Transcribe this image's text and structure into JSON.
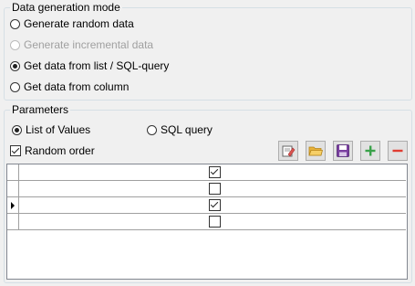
{
  "generation": {
    "legend": "Data generation mode",
    "options": [
      {
        "label": "Generate random data",
        "selected": false,
        "enabled": true
      },
      {
        "label": "Generate incremental data",
        "selected": false,
        "enabled": false
      },
      {
        "label": "Get data from list / SQL-query",
        "selected": true,
        "enabled": true
      },
      {
        "label": "Get data from column",
        "selected": false,
        "enabled": true
      }
    ]
  },
  "parameters": {
    "legend": "Parameters",
    "source_options": [
      {
        "label": "List of Values",
        "selected": true
      },
      {
        "label": "SQL query",
        "selected": false
      }
    ],
    "random_order": {
      "label": "Random order",
      "checked": true
    },
    "toolbar": [
      {
        "icon": "edit-icon"
      },
      {
        "icon": "open-folder-icon"
      },
      {
        "icon": "save-icon"
      },
      {
        "icon": "add-icon"
      },
      {
        "icon": "remove-icon"
      }
    ]
  },
  "grid": {
    "rows": [
      {
        "checked": true,
        "current": false
      },
      {
        "checked": false,
        "current": false
      },
      {
        "checked": true,
        "current": true
      },
      {
        "checked": false,
        "current": false
      }
    ]
  }
}
